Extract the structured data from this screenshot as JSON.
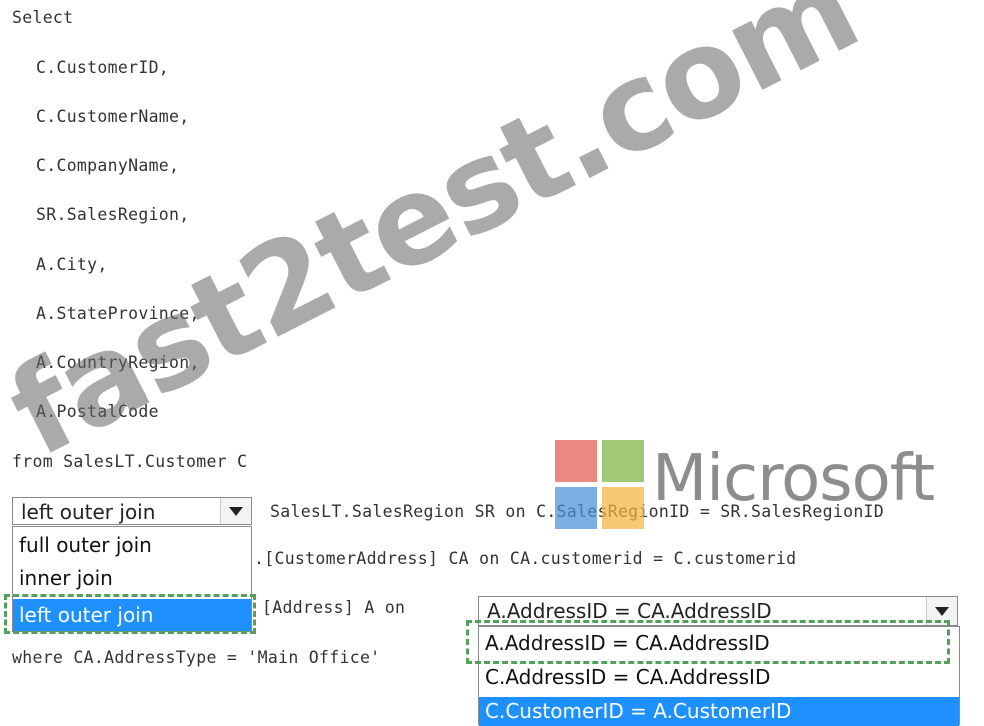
{
  "code": {
    "select": "Select",
    "columns": [
      "C.CustomerID,",
      "C.CustomerName,",
      "C.CompanyName,",
      "SR.SalesRegion,",
      "A.City,",
      "A.StateProvince,",
      "A.CountryRegion,",
      "A.PostalCode"
    ],
    "from": "from SalesLT.Customer C",
    "join1_rest": "SalesLT.SalesRegion SR on C.SalesRegionID = SR.SalesRegionID",
    "join2_rest": ".[CustomerAddress] CA on CA.customerid = C.customerid",
    "join3_rest": "[Address] A on",
    "where": "where CA.AddressType = 'Main Office'"
  },
  "join_dropdown": {
    "selected": "left outer join",
    "options": [
      "full outer join",
      "inner join",
      "left outer join"
    ],
    "highlighted_option": "left outer join"
  },
  "condition_dropdown": {
    "selected": "A.AddressID = CA.AddressID",
    "options": [
      "A.AddressID = CA.AddressID",
      "C.AddressID = CA.AddressID",
      "C.CustomerID = A.CustomerID"
    ],
    "highlighted_option": "C.CustomerID = A.CustomerID"
  },
  "logo": {
    "text": "Microsoft",
    "colors": [
      "#e25b4f",
      "#7cb342",
      "#4a90d9",
      "#f6b33c"
    ]
  },
  "watermark": "fast2test.com"
}
